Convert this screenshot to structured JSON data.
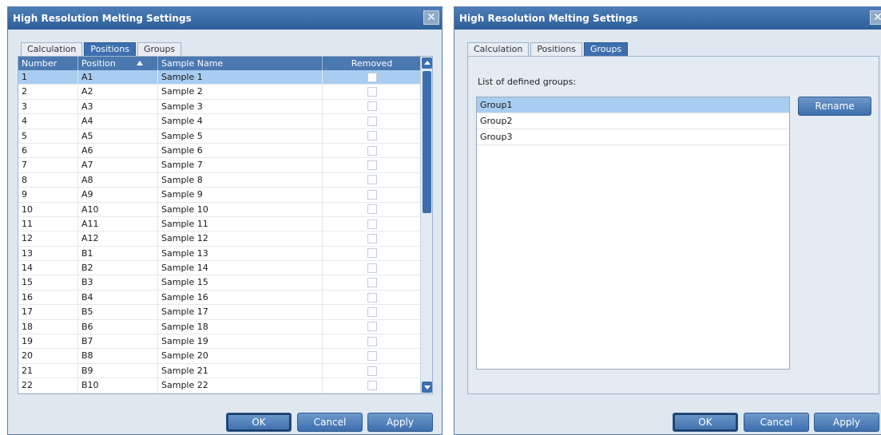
{
  "dialogA": {
    "title": "High Resolution Melting Settings",
    "close_glyph": "✕",
    "tabs": [
      "Calculation",
      "Positions",
      "Groups"
    ],
    "columns": [
      "Number",
      "Position",
      "Sample Name",
      "Removed"
    ],
    "rows": [
      [
        "1",
        "A1",
        "Sample 1"
      ],
      [
        "2",
        "A2",
        "Sample 2"
      ],
      [
        "3",
        "A3",
        "Sample 3"
      ],
      [
        "4",
        "A4",
        "Sample 4"
      ],
      [
        "5",
        "A5",
        "Sample 5"
      ],
      [
        "6",
        "A6",
        "Sample 6"
      ],
      [
        "7",
        "A7",
        "Sample 7"
      ],
      [
        "8",
        "A8",
        "Sample 8"
      ],
      [
        "9",
        "A9",
        "Sample 9"
      ],
      [
        "10",
        "A10",
        "Sample 10"
      ],
      [
        "11",
        "A11",
        "Sample 11"
      ],
      [
        "12",
        "A12",
        "Sample 12"
      ],
      [
        "13",
        "B1",
        "Sample 13"
      ],
      [
        "14",
        "B2",
        "Sample 14"
      ],
      [
        "15",
        "B3",
        "Sample 15"
      ],
      [
        "16",
        "B4",
        "Sample 16"
      ],
      [
        "17",
        "B5",
        "Sample 17"
      ],
      [
        "18",
        "B6",
        "Sample 18"
      ],
      [
        "19",
        "B7",
        "Sample 19"
      ],
      [
        "20",
        "B8",
        "Sample 20"
      ],
      [
        "21",
        "B9",
        "Sample 21"
      ],
      [
        "22",
        "B10",
        "Sample 22"
      ]
    ],
    "buttons": {
      "ok": "OK",
      "cancel": "Cancel",
      "apply": "Apply"
    }
  },
  "dialogB": {
    "title": "High Resolution Melting Settings",
    "close_glyph": "✕",
    "tabs": [
      "Calculation",
      "Positions",
      "Groups"
    ],
    "list_label": "List of defined groups:",
    "groups": [
      "Group1",
      "Group2",
      "Group3"
    ],
    "rename": "Rename",
    "buttons": {
      "ok": "OK",
      "cancel": "Cancel",
      "apply": "Apply"
    }
  }
}
